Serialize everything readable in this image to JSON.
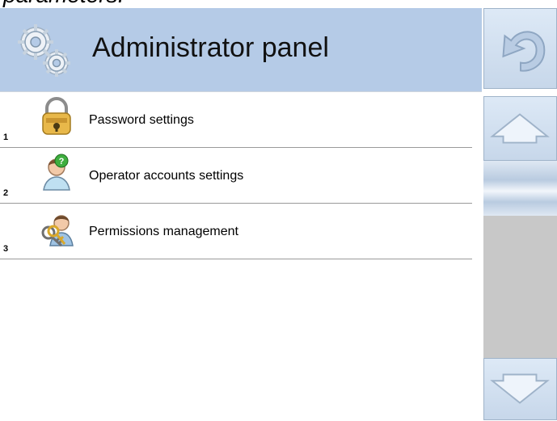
{
  "top_fragment": "parameters.",
  "header": {
    "title": "Administrator panel",
    "icon": "gears-icon"
  },
  "menu": {
    "items": [
      {
        "number": "1",
        "label": "Password settings",
        "icon": "padlock-icon"
      },
      {
        "number": "2",
        "label": "Operator accounts settings",
        "icon": "operator-question-icon"
      },
      {
        "number": "3",
        "label": "Permissions management",
        "icon": "user-key-icon"
      }
    ]
  },
  "sidebar": {
    "back_icon": "undo-arrow-icon",
    "up_icon": "arrow-up-icon",
    "down_icon": "arrow-down-icon"
  },
  "colors": {
    "header_bg": "#b5cbe7",
    "button_bg": "#d2e0f0",
    "scroll_track": "#c8c8c8"
  }
}
